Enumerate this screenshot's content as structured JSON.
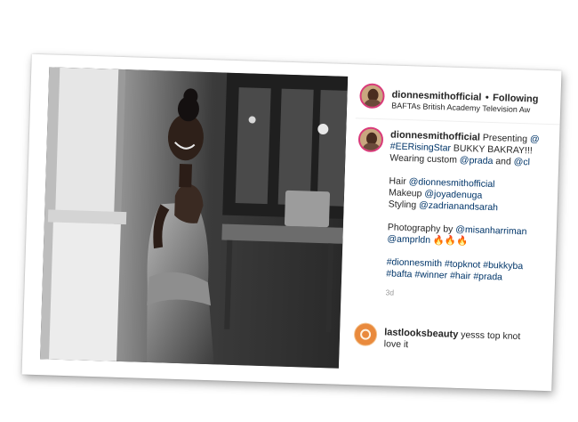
{
  "post": {
    "username": "dionnesmithofficial",
    "separator": "•",
    "follow_status": "Following",
    "location": "BAFTAs British Academy Television Aw",
    "caption_lines": [
      {
        "parts": [
          {
            "t": "Presenting ",
            "link": false
          },
          {
            "t": "@",
            "link": true
          }
        ]
      },
      {
        "parts": [
          {
            "t": "#EERisingStar",
            "link": true
          },
          {
            "t": " BUKKY BAKRAY!!!",
            "link": false
          }
        ]
      },
      {
        "parts": [
          {
            "t": "Wearing custom ",
            "link": false
          },
          {
            "t": "@prada",
            "link": true
          },
          {
            "t": " and ",
            "link": false
          },
          {
            "t": "@cl",
            "link": true
          }
        ]
      },
      {
        "parts": []
      },
      {
        "parts": [
          {
            "t": "Hair ",
            "link": false
          },
          {
            "t": "@dionnesmithofficial",
            "link": true
          }
        ]
      },
      {
        "parts": [
          {
            "t": "Makeup ",
            "link": false
          },
          {
            "t": "@joyadenuga",
            "link": true
          }
        ]
      },
      {
        "parts": [
          {
            "t": "Styling ",
            "link": false
          },
          {
            "t": "@zadrianandsarah",
            "link": true
          }
        ]
      },
      {
        "parts": []
      },
      {
        "parts": [
          {
            "t": "Photography by ",
            "link": false
          },
          {
            "t": "@misanharriman",
            "link": true
          }
        ]
      },
      {
        "parts": [
          {
            "t": "@amprldn",
            "link": true
          },
          {
            "t": " 🔥🔥🔥",
            "link": false
          }
        ]
      },
      {
        "parts": []
      },
      {
        "parts": [
          {
            "t": "#dionnesmith",
            "link": true
          },
          {
            "t": " ",
            "link": false
          },
          {
            "t": "#topknot",
            "link": true
          },
          {
            "t": " ",
            "link": false
          },
          {
            "t": "#bukkyba",
            "link": true
          }
        ]
      },
      {
        "parts": [
          {
            "t": "#bafta",
            "link": true
          },
          {
            "t": " ",
            "link": false
          },
          {
            "t": "#winner",
            "link": true
          },
          {
            "t": " ",
            "link": false
          },
          {
            "t": "#hair",
            "link": true
          },
          {
            "t": " ",
            "link": false
          },
          {
            "t": "#prada",
            "link": true
          }
        ]
      }
    ],
    "time_ago": "3d"
  },
  "comment": {
    "username": "lastlooksbeauty",
    "text_line1": " yesss top knot",
    "text_line2": "love it"
  },
  "colors": {
    "link": "#003569",
    "text": "#262626",
    "story_ring": "#d93a7a"
  },
  "icons": {
    "photo": "black-and-white-portrait-photo",
    "avatar": "profile-avatar",
    "comment_avatar": "lastlooksbeauty-logo"
  }
}
